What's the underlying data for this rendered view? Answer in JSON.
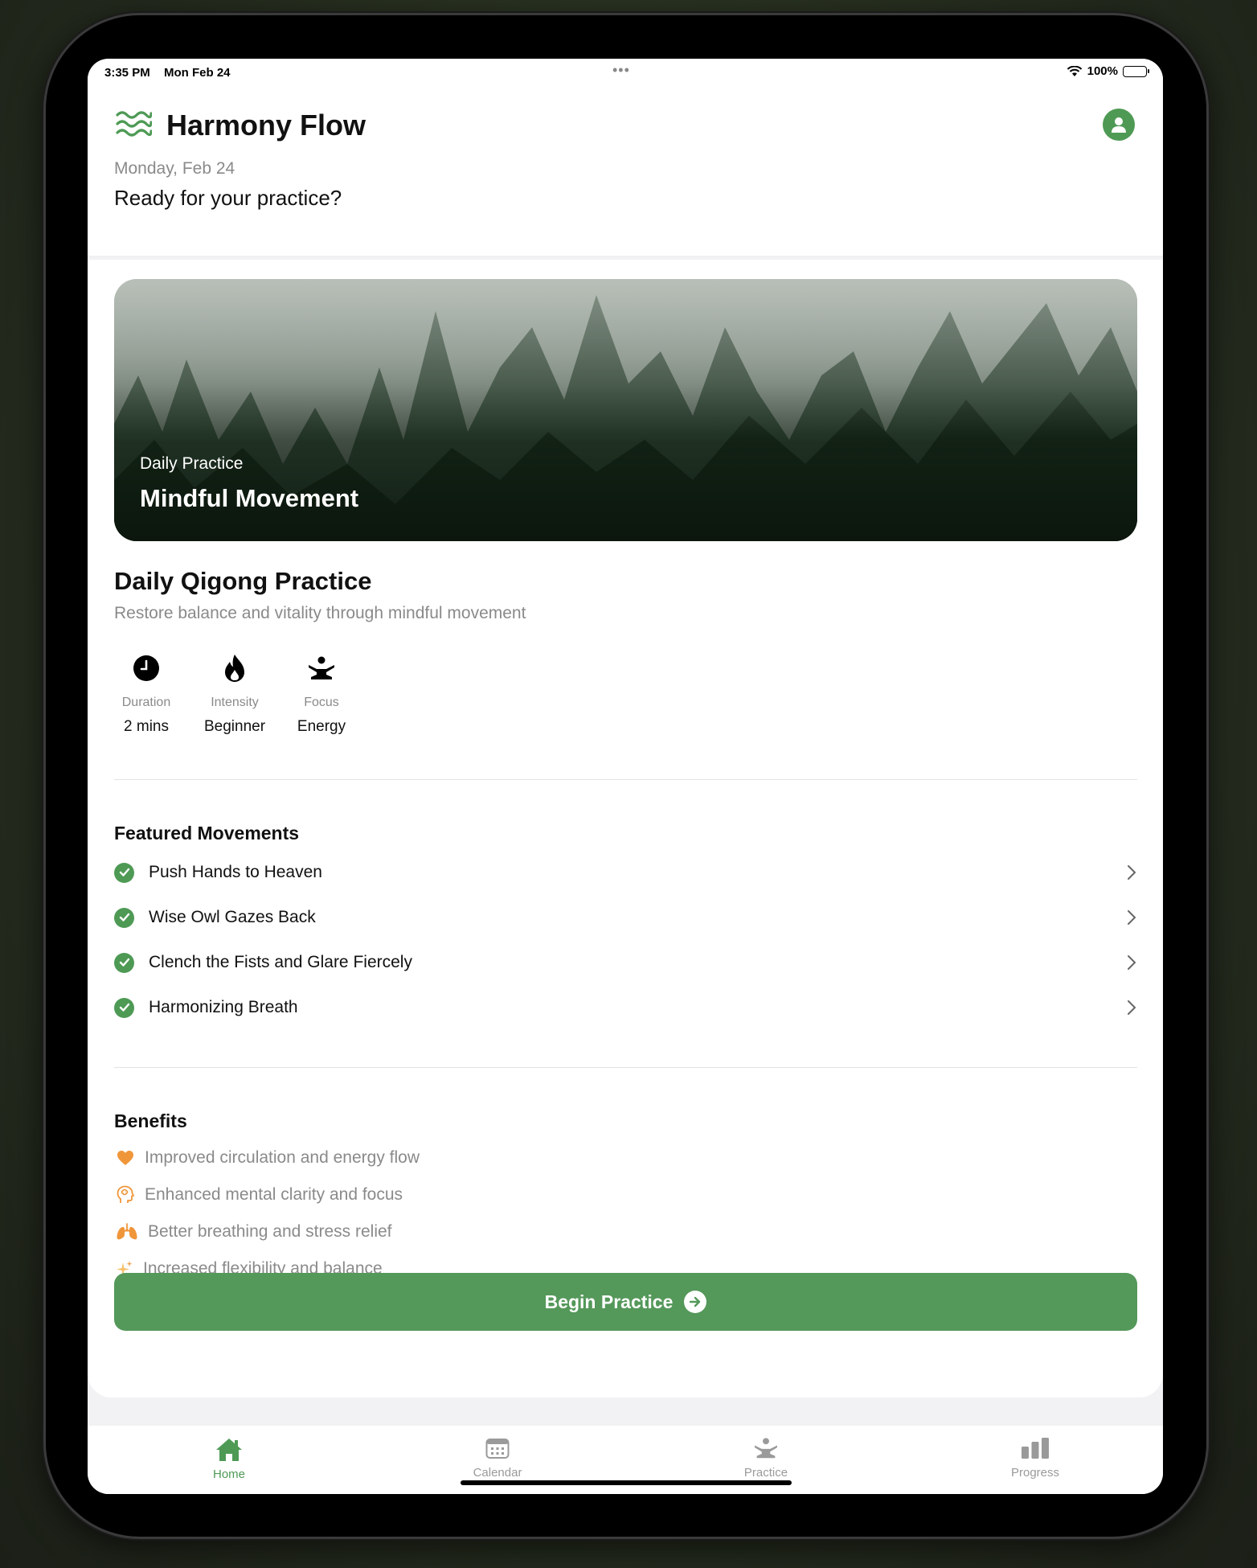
{
  "status_bar": {
    "time": "3:35 PM",
    "date": "Mon Feb 24",
    "dots": "•••",
    "battery": "100%"
  },
  "header": {
    "app_title": "Harmony Flow",
    "date": "Monday, Feb 24",
    "greeting": "Ready for your practice?",
    "logo_icon": "waves-icon",
    "profile_icon": "person-circle-icon"
  },
  "hero": {
    "subtitle": "Daily Practice",
    "title": "Mindful Movement"
  },
  "practice": {
    "title": "Daily Qigong Practice",
    "description": "Restore balance and vitality through mindful movement",
    "stats": [
      {
        "label": "Duration",
        "value": "2 mins",
        "icon": "clock-icon"
      },
      {
        "label": "Intensity",
        "value": "Beginner",
        "icon": "flame-icon"
      },
      {
        "label": "Focus",
        "value": "Energy",
        "icon": "meditation-icon"
      }
    ]
  },
  "featured": {
    "title": "Featured Movements",
    "items": [
      "Push Hands to Heaven",
      "Wise Owl Gazes Back",
      "Clench the Fists and Glare Fiercely",
      "Harmonizing Breath"
    ]
  },
  "benefits": {
    "title": "Benefits",
    "items": [
      {
        "label": "Improved circulation and energy flow",
        "icon": "heart-icon"
      },
      {
        "label": "Enhanced mental clarity and focus",
        "icon": "brain-head-icon"
      },
      {
        "label": "Better breathing and stress relief",
        "icon": "lungs-icon"
      },
      {
        "label": "Increased flexibility and balance",
        "icon": "sparkles-icon"
      }
    ]
  },
  "cta": {
    "label": "Begin Practice"
  },
  "tabs": [
    {
      "label": "Home",
      "icon": "house-icon",
      "active": true
    },
    {
      "label": "Calendar",
      "icon": "calendar-icon",
      "active": false
    },
    {
      "label": "Practice",
      "icon": "meditation-icon",
      "active": false
    },
    {
      "label": "Progress",
      "icon": "bar-chart-icon",
      "active": false
    }
  ],
  "colors": {
    "accent": "#4e9a55",
    "button": "#54985a",
    "benefit_orange": "#f0963a",
    "muted_text": "#8a8a8a"
  }
}
